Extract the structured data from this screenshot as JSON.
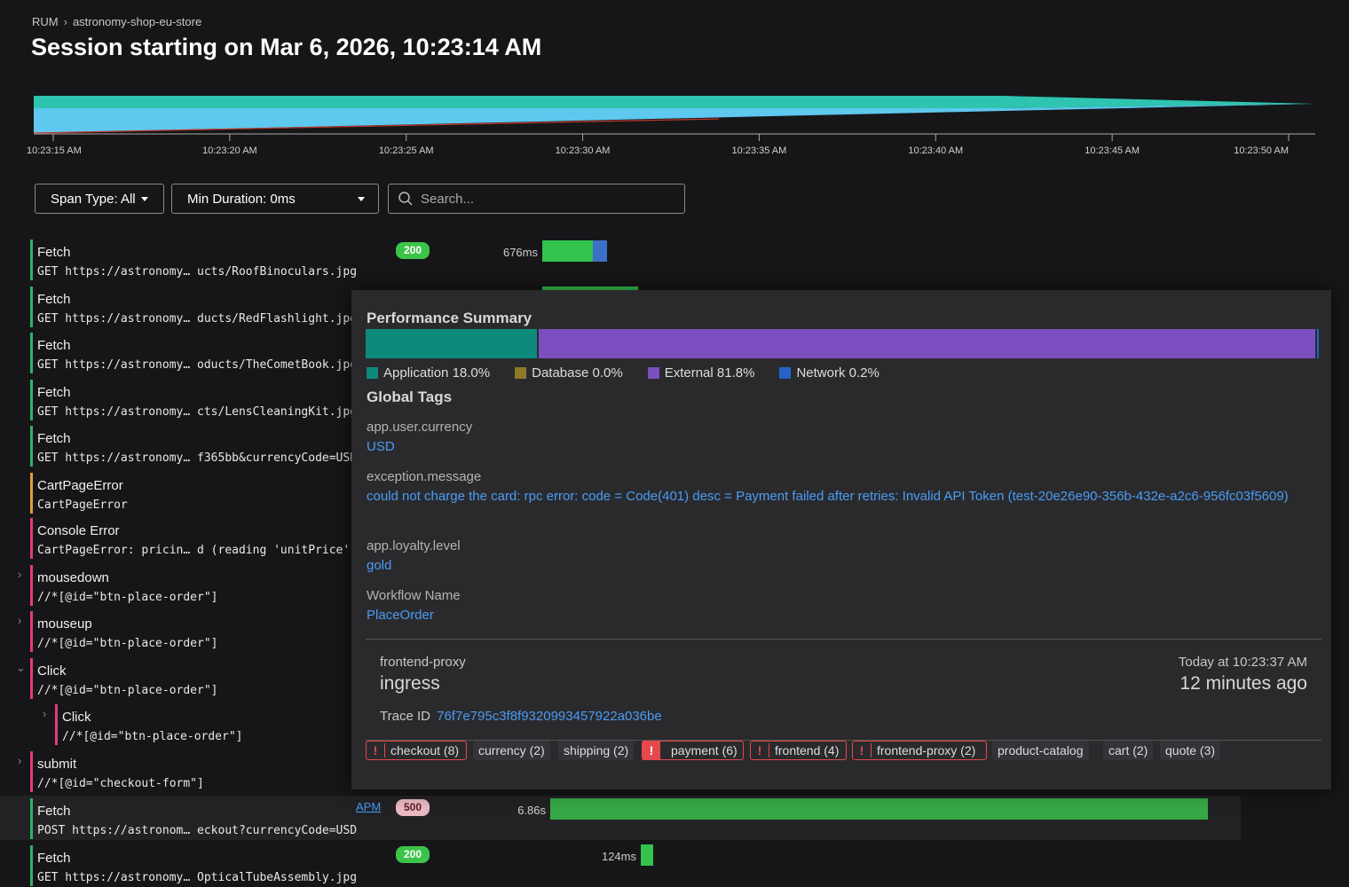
{
  "breadcrumb": {
    "root": "RUM",
    "app": "astronomy-shop-eu-store"
  },
  "title": "Session starting on Mar 6, 2026, 10:23:14 AM",
  "timeline": {
    "ticks": [
      "10:23:15 AM",
      "10:23:20 AM",
      "10:23:25 AM",
      "10:23:30 AM",
      "10:23:35 AM",
      "10:23:40 AM",
      "10:23:45 AM",
      "10:23:50 AM"
    ]
  },
  "filters": {
    "span_type": "Span Type: All",
    "min_duration": "Min Duration: 0ms",
    "search_placeholder": "Search..."
  },
  "rows": [
    {
      "title": "Fetch",
      "detail": "GET https://astronomy… ucts/RoofBinoculars.jpg",
      "status": "200",
      "duration": "676ms"
    },
    {
      "title": "Fetch",
      "detail": "GET https://astronomy… ducts/RedFlashlight.jpg"
    },
    {
      "title": "Fetch",
      "detail": "GET https://astronomy… oducts/TheCometBook.jpg"
    },
    {
      "title": "Fetch",
      "detail": "GET https://astronomy… cts/LensCleaningKit.jpg"
    },
    {
      "title": "Fetch",
      "detail": "GET https://astronomy… f365bb&currencyCode=USD"
    },
    {
      "title": "CartPageError",
      "detail": "CartPageError"
    },
    {
      "title": "Console Error",
      "detail": "CartPageError: pricin… d (reading 'unitPrice')"
    },
    {
      "title": "mousedown",
      "detail": "//*[@id=\"btn-place-order\"]"
    },
    {
      "title": "mouseup",
      "detail": "//*[@id=\"btn-place-order\"]"
    },
    {
      "title": "Click",
      "detail": "//*[@id=\"btn-place-order\"]"
    },
    {
      "title": "Click",
      "detail": "//*[@id=\"btn-place-order\"]"
    },
    {
      "title": "submit",
      "detail": "//*[@id=\"checkout-form\"]"
    },
    {
      "title": "Fetch",
      "detail": "POST https://astronom… eckout?currencyCode=USD",
      "status": "500",
      "duration": "6.86s",
      "link": "APM"
    },
    {
      "title": "Fetch",
      "detail": "GET https://astronomy… OpticalTubeAssembly.jpg",
      "status": "200",
      "duration": "124ms"
    }
  ],
  "panel": {
    "perf_title": "Performance Summary",
    "perf": [
      {
        "label": "Application",
        "pct": "18.0%",
        "value": 18.0,
        "color": "#0e8a7c"
      },
      {
        "label": "Database",
        "pct": "0.0%",
        "value": 0.0,
        "color": "#8a7a2a"
      },
      {
        "label": "External",
        "pct": "81.8%",
        "value": 81.8,
        "color": "#7b4fbf"
      },
      {
        "label": "Network",
        "pct": "0.2%",
        "value": 0.2,
        "color": "#2563c9"
      }
    ],
    "tags_title": "Global Tags",
    "tags": [
      {
        "key": "app.user.currency",
        "value": "USD"
      },
      {
        "key": "exception.message",
        "value": "could not charge the card: rpc error: code = Code(401) desc = Payment failed after retries: Invalid API Token (test-20e26e90-356b-432e-a2c6-956fc03f5609)"
      },
      {
        "key": "app.loyalty.level",
        "value": "gold"
      },
      {
        "key": "Workflow Name",
        "value": "PlaceOrder"
      }
    ],
    "service": "frontend-proxy",
    "operation": "ingress",
    "time_abs": "Today at 10:23:37 AM",
    "time_rel": "12 minutes ago",
    "trace_label": "Trace ID",
    "trace_id": "76f7e795c3f8f9320993457922a036be",
    "services": [
      {
        "name": "checkout (8)",
        "error": true
      },
      {
        "name": "currency (2)",
        "error": false
      },
      {
        "name": "shipping (2)",
        "error": false
      },
      {
        "name": "payment (6)",
        "error": true,
        "strong": true
      },
      {
        "name": "frontend (4)",
        "error": true
      },
      {
        "name": "frontend-proxy (2)",
        "error": true
      },
      {
        "name": "product-catalog",
        "error": false
      },
      {
        "name": "cart (2)",
        "error": false
      },
      {
        "name": "quote (3)",
        "error": false
      }
    ]
  }
}
